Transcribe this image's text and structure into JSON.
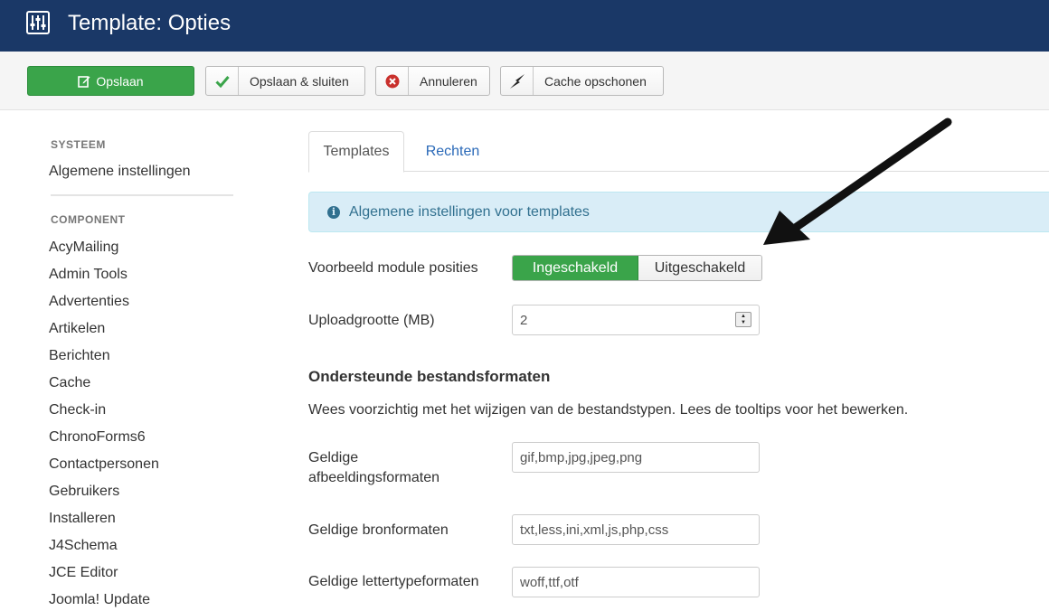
{
  "header": {
    "title": "Template: Opties",
    "icon": "sliders-icon"
  },
  "toolbar": {
    "save_label": "Opslaan",
    "save_close_label": "Opslaan & sluiten",
    "cancel_label": "Annuleren",
    "clear_cache_label": "Cache opschonen"
  },
  "sidebar": {
    "system_heading": "SYSTEEM",
    "system_items": [
      "Algemene instellingen"
    ],
    "component_heading": "COMPONENT",
    "component_items": [
      "AcyMailing",
      "Admin Tools",
      "Advertenties",
      "Artikelen",
      "Berichten",
      "Cache",
      "Check-in",
      "ChronoForms6",
      "Contactpersonen",
      "Gebruikers",
      "Installeren",
      "J4Schema",
      "JCE Editor",
      "Joomla! Update"
    ]
  },
  "tabs": [
    {
      "label": "Templates",
      "active": true
    },
    {
      "label": "Rechten",
      "active": false
    }
  ],
  "alert": {
    "text": "Algemene instellingen voor templates"
  },
  "form": {
    "preview_label": "Voorbeeld module posities",
    "preview_on": "Ingeschakeld",
    "preview_off": "Uitgeschakeld",
    "upload_label": "Uploadgrootte (MB)",
    "upload_value": "2",
    "formats_title": "Ondersteunde bestandsformaten",
    "formats_desc": "Wees voorzichtig met het wijzigen van de bestandstypen. Lees de tooltips voor het bewerken.",
    "image_formats_label_1": "Geldige",
    "image_formats_label_2": "afbeeldingsformaten",
    "image_formats_value": "gif,bmp,jpg,jpeg,png",
    "source_formats_label": "Geldige bronformaten",
    "source_formats_value": "txt,less,ini,xml,js,php,css",
    "font_formats_label": "Geldige lettertypeformaten",
    "font_formats_value": "woff,ttf,otf"
  },
  "colors": {
    "header_bg": "#1a3867",
    "success": "#3aa44a",
    "link": "#2a69b8",
    "info_bg": "#d9edf7",
    "danger": "#c9302c"
  }
}
